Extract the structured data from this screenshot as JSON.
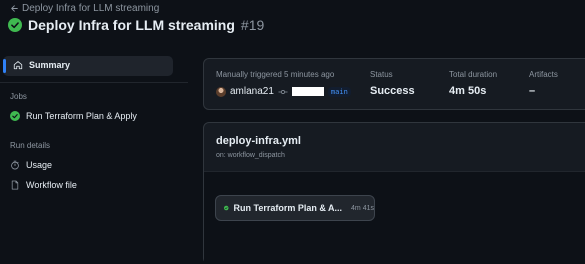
{
  "header": {
    "back_link_label": "Deploy Infra for LLM streaming",
    "run_title": "Deploy Infra for LLM streaming",
    "run_number": "#19"
  },
  "sidebar": {
    "summary_label": "Summary",
    "jobs_section_label": "Jobs",
    "jobs": [
      {
        "label": "Run Terraform Plan & Apply",
        "status": "success"
      }
    ],
    "run_details_label": "Run details",
    "details": [
      {
        "label": "Usage",
        "icon": "stopwatch-icon"
      },
      {
        "label": "Workflow file",
        "icon": "file-icon"
      }
    ]
  },
  "summary": {
    "trigger_text": "Manually triggered 5 minutes ago",
    "actor": "amlana21",
    "branch": "main",
    "status_label": "Status",
    "status_value": "Success",
    "duration_label": "Total duration",
    "duration_value": "4m 50s",
    "artifacts_label": "Artifacts",
    "artifacts_value": "–"
  },
  "workflow": {
    "file": "deploy-infra.yml",
    "trigger": "on: workflow_dispatch",
    "job_label": "Run Terraform Plan & A...",
    "job_duration": "4m 41s"
  },
  "colors": {
    "background": "#0d1117",
    "success": "#3fb950",
    "accent": "#2f81f7",
    "branch_text": "#4493f8"
  }
}
